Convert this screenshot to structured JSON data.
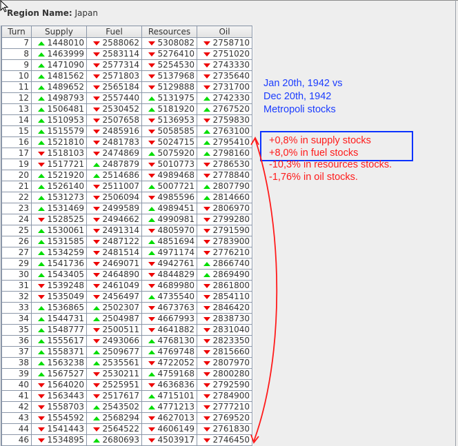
{
  "region": {
    "label": "Region Name:",
    "value": "Japan"
  },
  "table": {
    "headers": [
      "Turn",
      "Supply",
      "Fuel",
      "Resources",
      "Oil"
    ],
    "rows": [
      [
        "7",
        "u1448010",
        "d2588062",
        "d5308082",
        "d2758710"
      ],
      [
        "8",
        "u1463999",
        "d2583114",
        "d5276410",
        "d2751020"
      ],
      [
        "9",
        "u1471090",
        "d2577314",
        "d5254530",
        "d2743330"
      ],
      [
        "10",
        "u1481562",
        "d2571803",
        "d5137968",
        "d2735640"
      ],
      [
        "11",
        "u1489652",
        "d2565184",
        "d5129888",
        "d2731700"
      ],
      [
        "12",
        "u1498793",
        "d2557440",
        "u5131975",
        "u2742330"
      ],
      [
        "13",
        "u1506481",
        "d2530452",
        "u5181920",
        "u2767520"
      ],
      [
        "14",
        "u1510953",
        "d2507658",
        "d5136953",
        "d2759830"
      ],
      [
        "15",
        "u1515579",
        "d2485916",
        "d5058585",
        "u2763100"
      ],
      [
        "16",
        "u1521810",
        "d2481783",
        "d5024715",
        "u2795410"
      ],
      [
        "17",
        "d1518103",
        "d2474869",
        "u5075920",
        "u2798160"
      ],
      [
        "19",
        "d1517721",
        "u2487879",
        "d5010773",
        "d2786530"
      ],
      [
        "20",
        "u1521920",
        "u2514686",
        "d4989468",
        "d2778840"
      ],
      [
        "21",
        "u1526140",
        "d2511007",
        "u5007721",
        "u2807790"
      ],
      [
        "22",
        "u1531273",
        "d2506094",
        "d4985596",
        "u2814660"
      ],
      [
        "23",
        "u1531469",
        "d2499589",
        "u4989451",
        "d2806970"
      ],
      [
        "24",
        "d1528525",
        "d2494662",
        "u4990981",
        "d2799280"
      ],
      [
        "25",
        "u1530061",
        "d2491314",
        "d4805970",
        "d2791590"
      ],
      [
        "26",
        "u1531585",
        "d2487122",
        "u4851694",
        "d2783900"
      ],
      [
        "27",
        "u1534259",
        "d2481514",
        "u4971174",
        "d2776210"
      ],
      [
        "29",
        "u1541736",
        "d2469071",
        "d4942761",
        "u2866740"
      ],
      [
        "30",
        "u1543405",
        "d2464890",
        "d4844829",
        "u2869490"
      ],
      [
        "31",
        "d1539248",
        "d2461049",
        "d4689980",
        "d2861800"
      ],
      [
        "32",
        "d1535049",
        "d2456497",
        "u4735540",
        "d2854110"
      ],
      [
        "33",
        "u1536865",
        "u2502307",
        "d4673763",
        "d2846420"
      ],
      [
        "34",
        "u1544731",
        "u2504987",
        "d4667993",
        "d2838730"
      ],
      [
        "35",
        "u1548777",
        "d2500511",
        "d4641882",
        "d2831040"
      ],
      [
        "36",
        "u1555617",
        "d2493066",
        "u4768130",
        "d2823350"
      ],
      [
        "37",
        "u1558371",
        "u2509677",
        "u4769748",
        "d2815660"
      ],
      [
        "38",
        "u1563238",
        "u2535561",
        "d4722052",
        "d2807970"
      ],
      [
        "39",
        "u1567527",
        "d2530211",
        "u4759168",
        "d2800280"
      ],
      [
        "40",
        "d1564020",
        "d2525951",
        "d4636836",
        "d2792590"
      ],
      [
        "41",
        "d1563443",
        "d2517617",
        "u4715101",
        "d2784900"
      ],
      [
        "42",
        "d1558703",
        "u2543502",
        "u4771213",
        "d2777210"
      ],
      [
        "43",
        "d1554592",
        "u2568294",
        "d4627013",
        "d2769520"
      ],
      [
        "44",
        "d1541443",
        "d2564522",
        "d4606149",
        "d2761830"
      ],
      [
        "46",
        "d1534895",
        "u2680693",
        "d4503917",
        "d2746450"
      ]
    ]
  },
  "annotations": {
    "blue": [
      "Jan 20th, 1942 vs",
      "Dec 20th, 1942",
      "Metropoli stocks"
    ],
    "red": [
      "+0,8% in supply stocks",
      "+8,0% in fuel stocks",
      "-10,3% in resources stocks.",
      "-1,76% in oil stocks."
    ]
  },
  "colors": {
    "up": "#00dd00",
    "down": "#ee0000",
    "note_blue": "#1a3cff",
    "note_red": "#ff1a1a"
  }
}
